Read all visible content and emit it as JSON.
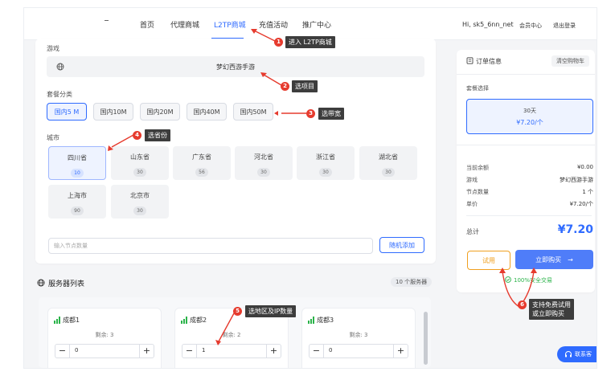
{
  "header": {
    "nav": [
      "首页",
      "代理商城",
      "L2TP商城",
      "充值活动",
      "推广中心"
    ],
    "active_nav": "L2TP商城",
    "username": "Hi, sk5_6nn_net",
    "member_center": "会员中心",
    "logout": "退出登录"
  },
  "config": {
    "game_label": "游戏",
    "game_value": "梦幻西游手游",
    "package_label": "套餐分类",
    "packages": [
      "国内5 M",
      "国内10M",
      "国内20M",
      "国内40M",
      "国内50M"
    ],
    "selected_package": "国内5 M",
    "city_label": "城市",
    "cities": [
      {
        "name": "四川省",
        "count": "10"
      },
      {
        "name": "山东省",
        "count": "30"
      },
      {
        "name": "广东省",
        "count": "56"
      },
      {
        "name": "河北省",
        "count": "30"
      },
      {
        "name": "浙江省",
        "count": "30"
      },
      {
        "name": "湖北省",
        "count": "30"
      },
      {
        "name": "上海市",
        "count": "90"
      },
      {
        "name": "北京市",
        "count": "30"
      }
    ],
    "selected_city": "四川省",
    "node_input_placeholder": "输入节点数量",
    "random_add": "随机添加"
  },
  "servers": {
    "title": "服务器列表",
    "count_badge": "10 个服务器",
    "items": [
      {
        "name": "成都1",
        "remain": "剩余: 3",
        "value": "0"
      },
      {
        "name": "成都2",
        "remain": "剩余: 2",
        "value": "1"
      },
      {
        "name": "成都3",
        "remain": "剩余: 3",
        "value": "0"
      }
    ]
  },
  "order": {
    "title": "订单信息",
    "clear_cart": "清空购物车",
    "package_select_label": "套餐选择",
    "plan_days": "30天",
    "plan_price": "¥7.20/个",
    "rows": [
      {
        "label": "当前余额",
        "value": "¥0.00"
      },
      {
        "label": "游戏",
        "value": "梦幻西游手游"
      },
      {
        "label": "节点数量",
        "value": "1 个"
      },
      {
        "label": "单价",
        "value": "¥7.20/个"
      }
    ],
    "total_label": "总计",
    "total_value": "¥7.20",
    "trial_button": "试用",
    "buy_button": "立即购买",
    "secure_text": "100%安全交易"
  },
  "support": {
    "label": "联系客"
  },
  "annotations": [
    {
      "n": "1",
      "text": "进入 L2TP商城"
    },
    {
      "n": "2",
      "text": "选项目"
    },
    {
      "n": "3",
      "text": "选带宽"
    },
    {
      "n": "4",
      "text": "选省份"
    },
    {
      "n": "5",
      "text": "选地区及IP数量"
    },
    {
      "n": "6",
      "text": "支持免费试用\n或立即购买"
    }
  ],
  "colors": {
    "accent": "#2f6bff",
    "annotation_bg": "#3d3d3d",
    "badge": "#e63b2e",
    "signal": "#2bb34a",
    "trial": "#f0a020"
  }
}
